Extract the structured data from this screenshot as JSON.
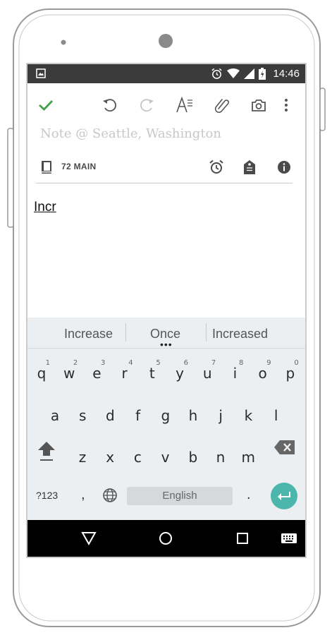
{
  "status_bar": {
    "time": "14:46"
  },
  "toolbar": {
    "icons": [
      "checkmark-icon",
      "undo-icon",
      "redo-icon",
      "text-format-icon",
      "attachment-icon",
      "camera-icon",
      "more-vert-icon"
    ]
  },
  "note": {
    "title_placeholder": "Note @ Seattle, Washington",
    "notebook": "72 MAIN",
    "body": "Incr"
  },
  "keyboard": {
    "suggestions": [
      "Increase",
      "Once",
      "Increased"
    ],
    "row1": [
      {
        "key": "q",
        "num": "1"
      },
      {
        "key": "w",
        "num": "2"
      },
      {
        "key": "e",
        "num": "3"
      },
      {
        "key": "r",
        "num": "4"
      },
      {
        "key": "t",
        "num": "5"
      },
      {
        "key": "y",
        "num": "6"
      },
      {
        "key": "u",
        "num": "7"
      },
      {
        "key": "i",
        "num": "8"
      },
      {
        "key": "o",
        "num": "9"
      },
      {
        "key": "p",
        "num": "0"
      }
    ],
    "row2": [
      "a",
      "s",
      "d",
      "f",
      "g",
      "h",
      "j",
      "k",
      "l"
    ],
    "row3": [
      "z",
      "x",
      "c",
      "v",
      "b",
      "n",
      "m"
    ],
    "symbols_label": "?123",
    "comma": ",",
    "period": ".",
    "space_label": "English"
  },
  "colors": {
    "accent_green": "#43a047",
    "enter_teal": "#4db6ac",
    "status_bar": "#3b3b3b"
  }
}
